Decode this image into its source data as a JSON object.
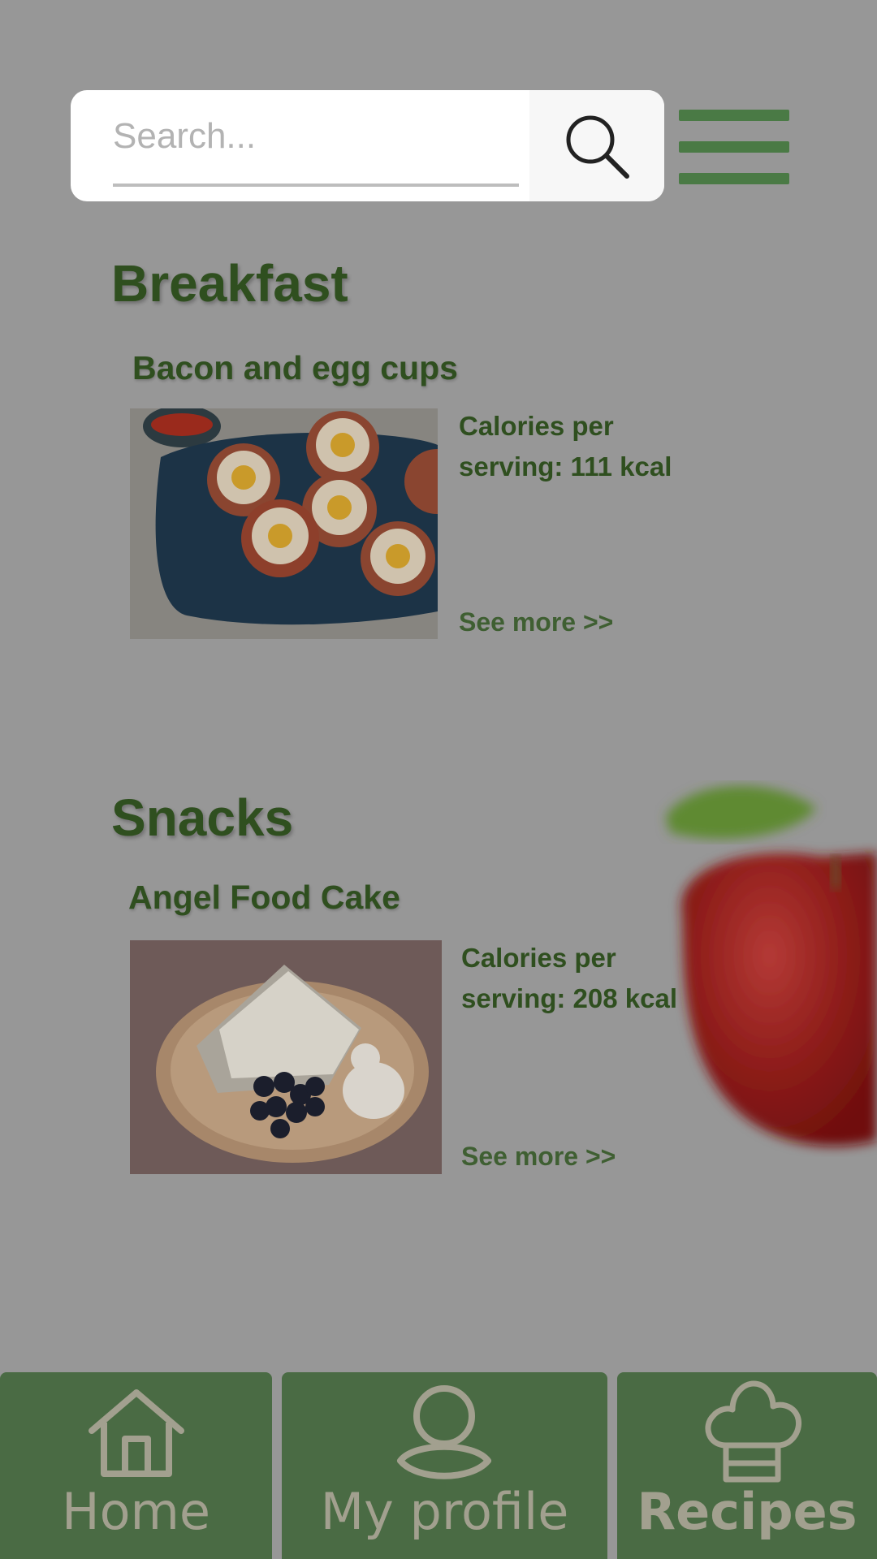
{
  "search": {
    "placeholder": "Search...",
    "value": "",
    "button_icon": "search-icon"
  },
  "menu": {
    "icon": "hamburger-menu-icon"
  },
  "sections": [
    {
      "title": "Breakfast",
      "recipe": {
        "name": "Bacon and egg cups",
        "calories": "Calories per serving: 111 kcal",
        "link": "See more >>"
      }
    },
    {
      "title": "Snacks",
      "recipe": {
        "name": "Angel Food Cake",
        "calories": "Calories per serving: 208 kcal",
        "link": "See more >>"
      }
    }
  ],
  "decoration": {
    "icon": "apple-illustration"
  },
  "nav": {
    "tabs": [
      {
        "label": "Home",
        "icon": "home-icon",
        "active": false
      },
      {
        "label": "My profile",
        "icon": "user-icon",
        "active": false
      },
      {
        "label": "Recipes",
        "icon": "chef-hat-icon",
        "active": true
      }
    ]
  },
  "colors": {
    "background": "#979797",
    "accent_green": "#4a6b44",
    "title_green": "#2f4f1f",
    "nav_text": "#a2a08f"
  }
}
